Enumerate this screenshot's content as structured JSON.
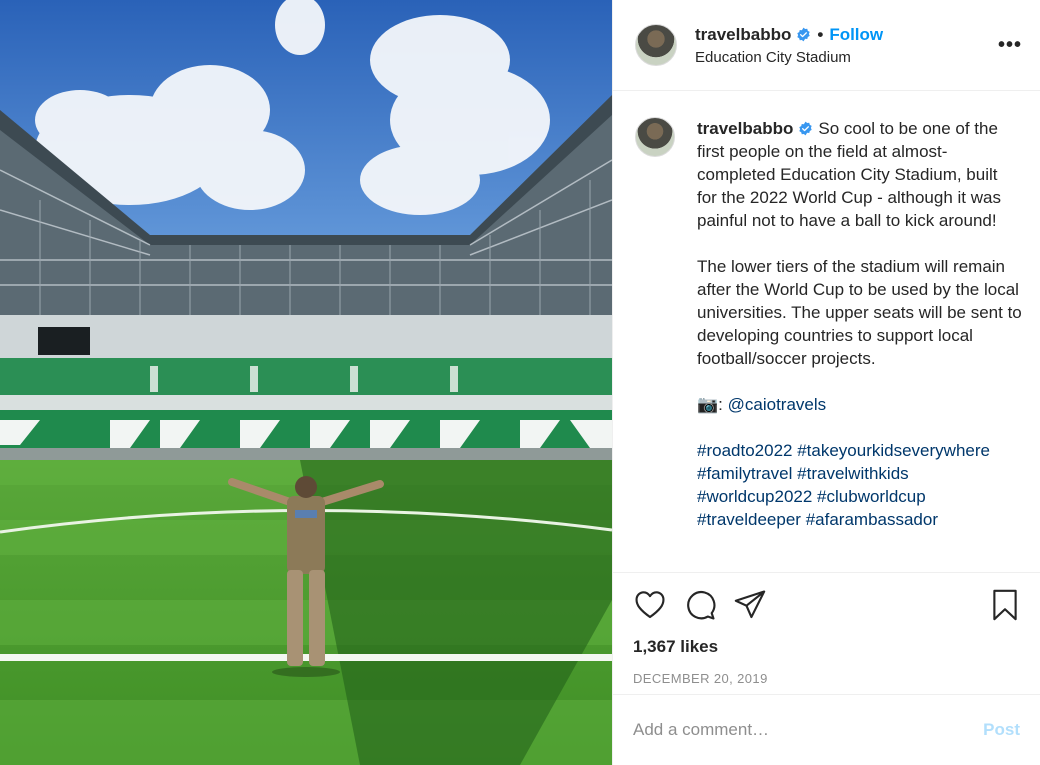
{
  "post": {
    "author": {
      "username": "travelbabbo",
      "verified": true,
      "follow_label": "Follow",
      "separator": "•",
      "location": "Education City Stadium"
    },
    "more_label": "•••",
    "caption": {
      "username": "travelbabbo",
      "paragraphs": [
        "So cool to be one of the first people on the field at almost-completed Education City Stadium, built for the 2022 World Cup - although it was painful not to have a ball to kick around!",
        "The lower tiers of the stadium will remain after the World Cup to be used by the local universities. The upper seats will be sent to developing countries to support local football/soccer projects."
      ],
      "credit_prefix": "📷: ",
      "credit_mention": "@caiotravels",
      "hashtags": [
        "#roadto2022",
        "#takeyourkidseverywhere",
        "#familytravel",
        "#travelwithkids",
        "#worldcup2022",
        "#clubworldcup",
        "#traveldeeper",
        "#afarambassador"
      ]
    },
    "actions": {
      "icons": [
        "heart-icon",
        "comment-icon",
        "share-icon",
        "bookmark-icon"
      ]
    },
    "likes": "1,367 likes",
    "date": "DECEMBER 20, 2019",
    "comment": {
      "placeholder": "Add a comment…",
      "post_label": "Post"
    },
    "colors": {
      "link_blue": "#0095f6",
      "hashtag": "#00376b",
      "verified_blue": "#3897f0",
      "post_disabled": "#b2dffc",
      "pitch_green": "#4c9a2a",
      "seats_green": "#1e8a4c",
      "sky_blue": "#2f6fc2"
    }
  }
}
